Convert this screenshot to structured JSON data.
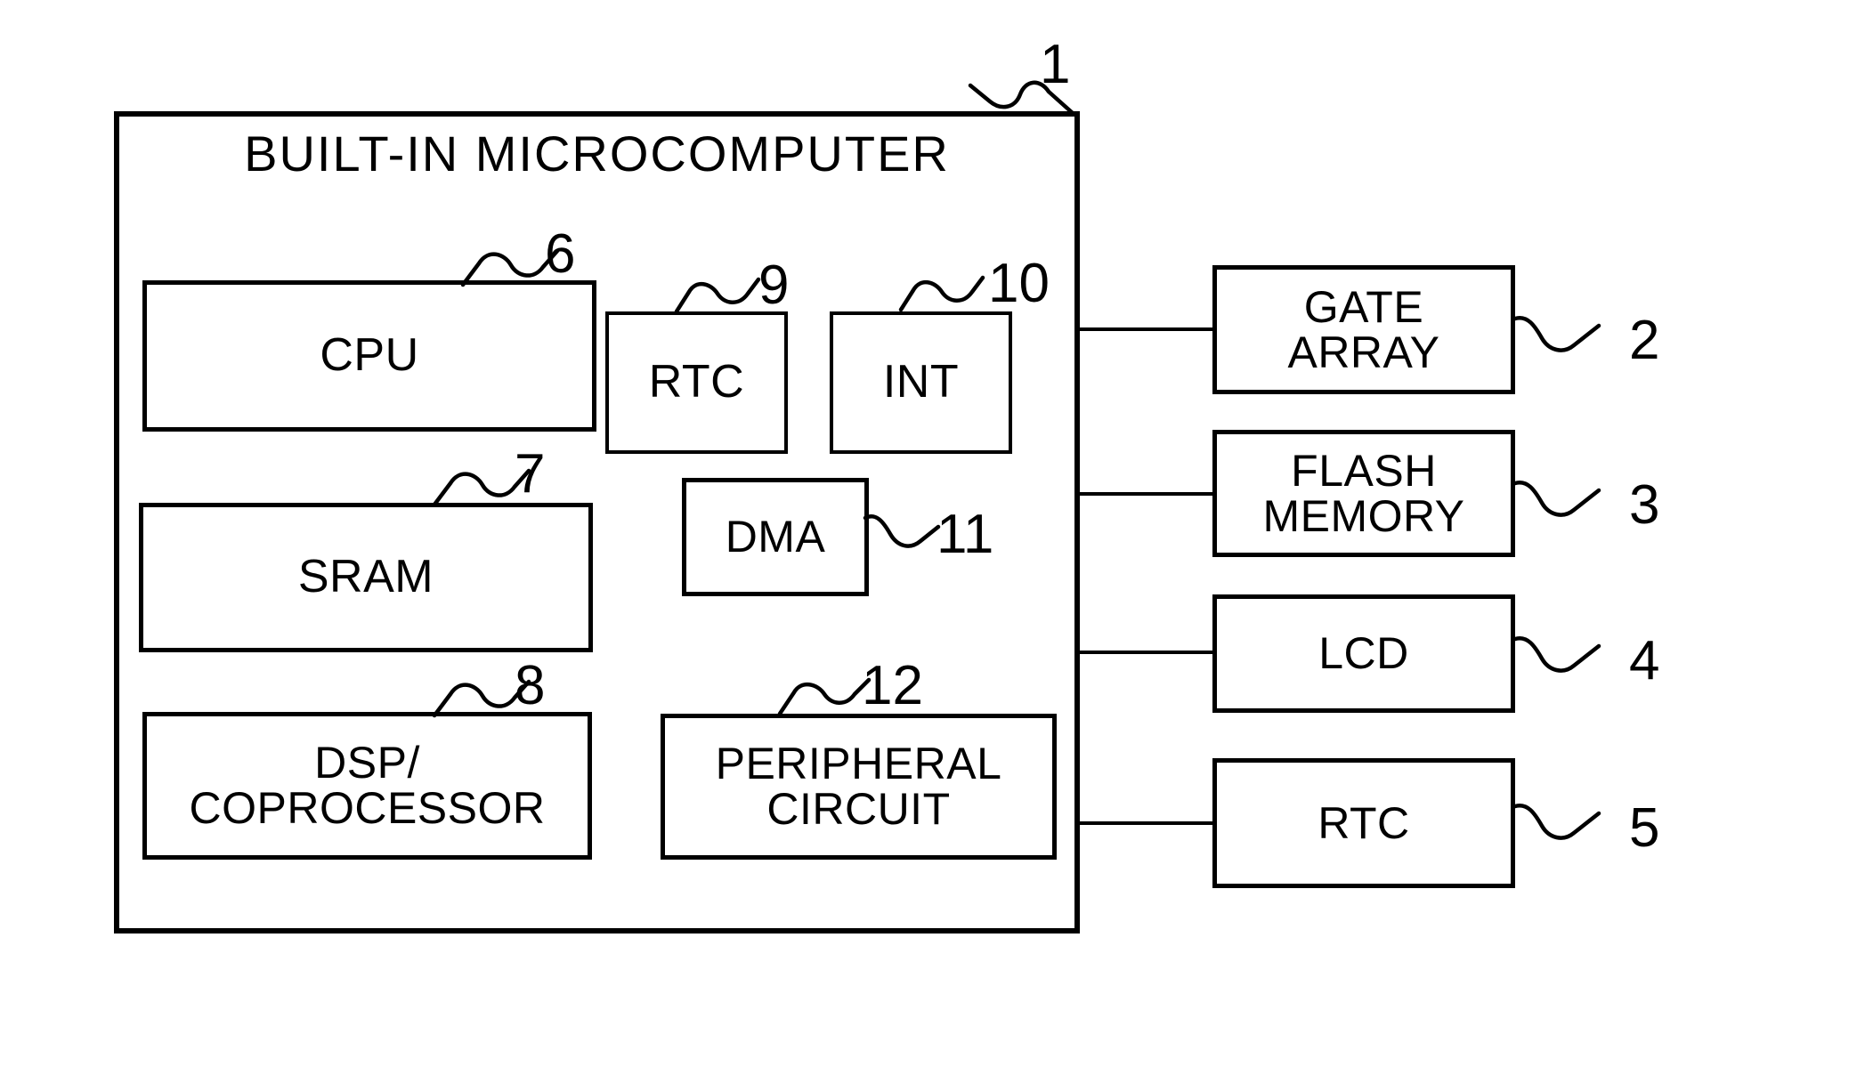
{
  "figure": {
    "type": "block-diagram",
    "chip": {
      "title": "BUILT-IN MICROCOMPUTER",
      "ref": "1"
    },
    "internal_blocks": [
      {
        "id": "cpu",
        "label": "CPU",
        "ref": "6"
      },
      {
        "id": "rtc",
        "label": "RTC",
        "ref": "9"
      },
      {
        "id": "int",
        "label": "INT",
        "ref": "10"
      },
      {
        "id": "sram",
        "label": "SRAM",
        "ref": "7"
      },
      {
        "id": "dma",
        "label": "DMA",
        "ref": "11"
      },
      {
        "id": "dsp",
        "label": "DSP/\nCOPROCESSOR",
        "ref": "8"
      },
      {
        "id": "periph",
        "label": "PERIPHERAL\nCIRCUIT",
        "ref": "12"
      }
    ],
    "external_blocks": [
      {
        "id": "gate",
        "label": "GATE\nARRAY",
        "ref": "2"
      },
      {
        "id": "flash",
        "label": "FLASH\nMEMORY",
        "ref": "3"
      },
      {
        "id": "lcd",
        "label": "LCD",
        "ref": "4"
      },
      {
        "id": "ertc",
        "label": "RTC",
        "ref": "5"
      }
    ],
    "labels": {
      "cpu": "CPU",
      "rtc": "RTC",
      "int": "INT",
      "sram": "SRAM",
      "dma": "DMA",
      "dsp_line1": "DSP/",
      "dsp_line2": "COPROCESSOR",
      "periph_line1": "PERIPHERAL",
      "periph_line2": "CIRCUIT",
      "gate_line1": "GATE",
      "gate_line2": "ARRAY",
      "flash_line1": "FLASH",
      "flash_line2": "MEMORY",
      "lcd": "LCD",
      "ertc": "RTC"
    },
    "refs": {
      "r1": "1",
      "r2": "2",
      "r3": "3",
      "r4": "4",
      "r5": "5",
      "r6": "6",
      "r7": "7",
      "r8": "8",
      "r9": "9",
      "r10": "10",
      "r11": "11",
      "r12": "12"
    },
    "colors": {
      "ink": "#000000",
      "paper": "#ffffff"
    }
  }
}
